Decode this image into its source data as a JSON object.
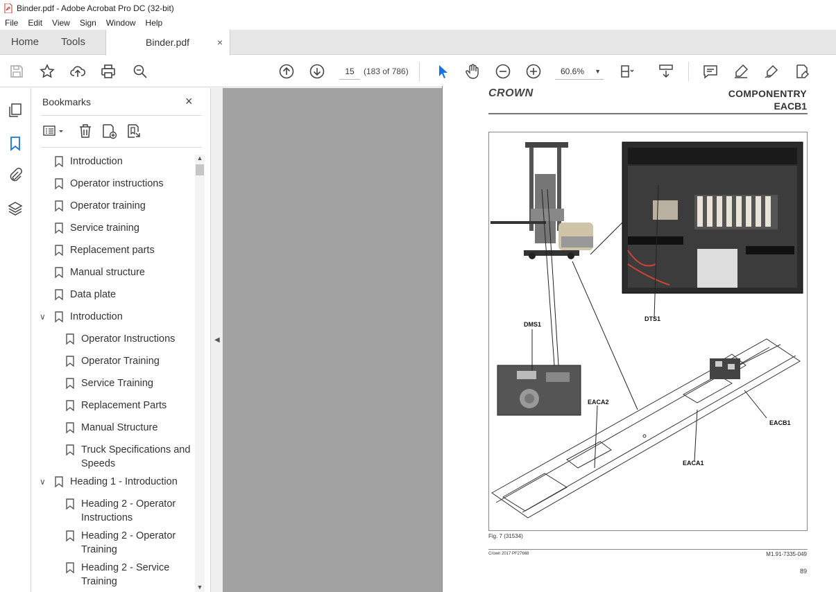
{
  "window": {
    "title": "Binder.pdf - Adobe Acrobat Pro DC (32-bit)"
  },
  "menu": [
    "File",
    "Edit",
    "View",
    "Sign",
    "Window",
    "Help"
  ],
  "tabs": {
    "home": "Home",
    "tools": "Tools",
    "document": "Binder.pdf",
    "close": "×"
  },
  "toolbar": {
    "page_number": "15",
    "page_count": "(183 of 786)",
    "zoom": "60.6%"
  },
  "bookmarks": {
    "title": "Bookmarks",
    "close": "×",
    "items": [
      {
        "label": "Introduction"
      },
      {
        "label": "Operator instructions"
      },
      {
        "label": "Operator training"
      },
      {
        "label": "Service training"
      },
      {
        "label": "Replacement parts"
      },
      {
        "label": "Manual structure"
      },
      {
        "label": "Data plate"
      },
      {
        "label": "Introduction"
      },
      {
        "label": "Operator Instructions"
      },
      {
        "label": "Operator Training"
      },
      {
        "label": "Service Training"
      },
      {
        "label": "Replacement Parts"
      },
      {
        "label": "Manual Structure"
      },
      {
        "label": "Truck Specifications and",
        "label2": "Speeds"
      },
      {
        "label": "Heading 1 - Introduction"
      },
      {
        "label": "Heading 2 - Operator",
        "label2": "Instructions"
      },
      {
        "label": "Heading 2 - Operator",
        "label2": "Training"
      },
      {
        "label": "Heading 2 - Service",
        "label2": "Training"
      }
    ]
  },
  "document": {
    "logo": "CROWN",
    "header_title": "COMPONENTRY",
    "header_sub": "EACB1",
    "callouts": {
      "dms1": "DMS1",
      "dts1": "DTS1",
      "eaca2": "EACA2",
      "eaca1": "EACA1",
      "eacb1": "EACB1"
    },
    "figure_caption": "Fig. 7 (31534)",
    "footer_left": "Crown 2017 PF27668",
    "footer_right": "M1.91-7335-049",
    "page_number": "89"
  }
}
